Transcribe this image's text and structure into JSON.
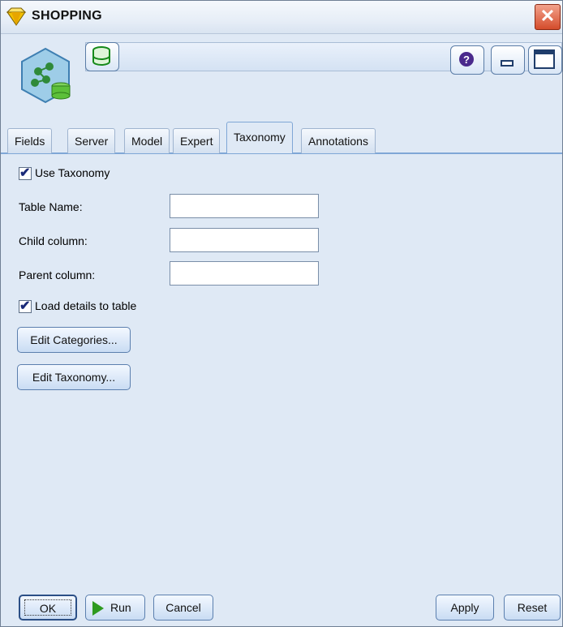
{
  "window": {
    "title": "SHOPPING"
  },
  "icons": {
    "title": "diamond-node-icon",
    "node": "association-model-node-icon",
    "database": "database-icon",
    "help": "help-icon",
    "minimize": "minimize-icon",
    "maximize": "maximize-icon",
    "close": "close-icon"
  },
  "tabs": [
    {
      "label": "Fields",
      "active": false
    },
    {
      "label": "Server",
      "active": false
    },
    {
      "label": "Model",
      "active": false
    },
    {
      "label": "Expert",
      "active": false
    },
    {
      "label": "Taxonomy",
      "active": true
    },
    {
      "label": "Annotations",
      "active": false
    }
  ],
  "taxonomy": {
    "use_taxonomy": {
      "label": "Use Taxonomy",
      "checked": true
    },
    "table_name": {
      "label": "Table Name:",
      "value": ""
    },
    "child_column": {
      "label": "Child column:",
      "value": ""
    },
    "parent_column": {
      "label": "Parent column:",
      "value": ""
    },
    "load_details": {
      "label": "Load details to table",
      "checked": true
    },
    "edit_categories_label": "Edit Categories...",
    "edit_taxonomy_label": "Edit Taxonomy..."
  },
  "buttons": {
    "ok": "OK",
    "run": "Run",
    "cancel": "Cancel",
    "apply": "Apply",
    "reset": "Reset"
  },
  "colors": {
    "panel_background": "#dfe9f5",
    "tab_underline": "#7fa7d6",
    "run_green": "#2e9a1f",
    "close_red": "#d44c2b"
  }
}
